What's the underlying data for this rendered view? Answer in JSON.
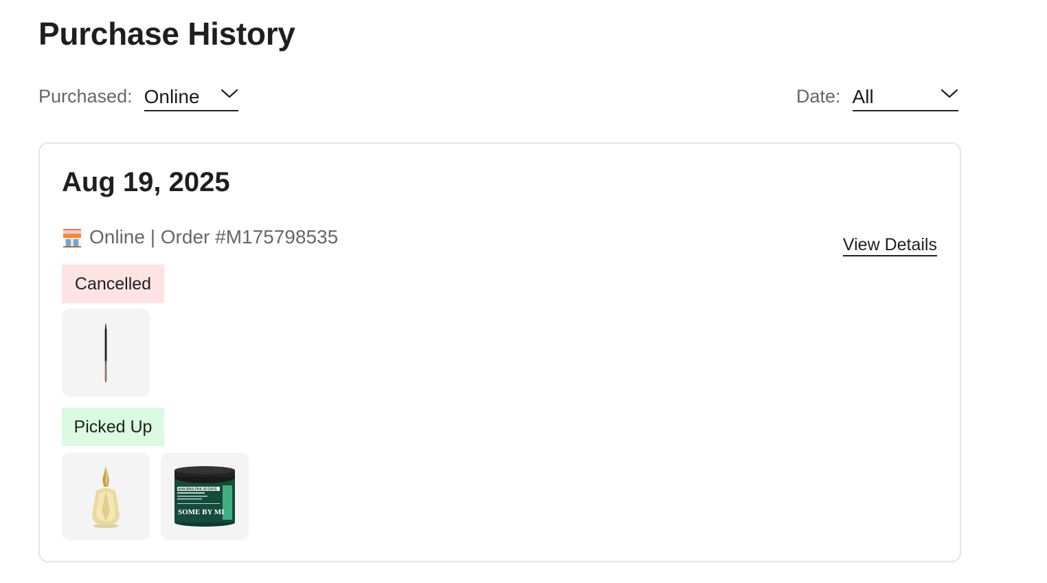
{
  "page": {
    "title": "Purchase History"
  },
  "filters": {
    "purchased": {
      "label": "Purchased:",
      "value": "Online"
    },
    "date": {
      "label": "Date:",
      "value": "All"
    }
  },
  "order": {
    "date": "Aug 19, 2025",
    "meta": "Online | Order #M175798535",
    "view_details_label": "View Details",
    "groups": [
      {
        "status": "Cancelled",
        "status_color": "#fde3e3",
        "items": [
          {
            "icon": "eyeliner-pencil-product-image"
          }
        ]
      },
      {
        "status": "Picked Up",
        "status_color": "#dafbe1",
        "items": [
          {
            "icon": "perfume-bottle-product-image"
          },
          {
            "icon": "skincare-jar-product-image",
            "brand_text": "SOME BY MI",
            "label_text": "AHA.BHA.PHA 30 DAYS"
          }
        ]
      }
    ]
  }
}
